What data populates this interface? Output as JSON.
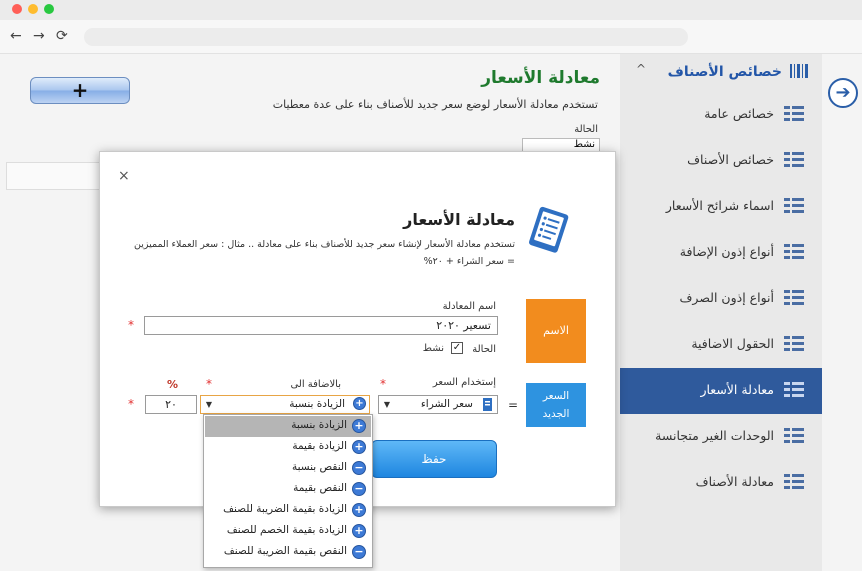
{
  "sidebar": {
    "header_title": "خصائص الأصناف",
    "items": [
      {
        "label": "خصائص عامة"
      },
      {
        "label": "خصائص الأصناف"
      },
      {
        "label": "اسماء شرائح الأسعار"
      },
      {
        "label": "أنواع إذون الإضافة"
      },
      {
        "label": "أنواع إذون الصرف"
      },
      {
        "label": "الحقول الاضافية"
      },
      {
        "label": "معادلة الأسعار"
      },
      {
        "label": "الوحدات الغير متجانسة"
      },
      {
        "label": "معادلة الأصناف"
      }
    ]
  },
  "page": {
    "title": "معادلة الأسعار",
    "description": "تستخدم معادلة الأسعار لوضع سعر جديد للأصناف بناء على عدة معطيات",
    "status_label": "الحالة",
    "status_value": "نشط",
    "add_button": "+"
  },
  "modal": {
    "close": "×",
    "title": "معادلة الأسعار",
    "description_line1": "تستخدم معادلة الأسعار لإنشاء سعر جديد للأصناف بناء على معادلة .. مثال : سعر العملاء المميزين",
    "description_line2": "= سعر الشراء + ٢٠%",
    "name_box": "الاسم",
    "new_price_box_line1": "السعر",
    "new_price_box_line2": "الجديد",
    "equation_name_label": "اسم المعادلة",
    "equation_name_value": "تسعير ٢٠٢٠",
    "status_label": "الحالة",
    "active_label": "نشط",
    "active_checked": true,
    "use_price_label": "إستخدام السعر",
    "use_price_value": "سعر الشراء",
    "addition_label": "بالاضافة الى",
    "addition_value": "الزيادة بنسبة",
    "percent_label": "%",
    "percent_value": "٢٠",
    "equals": "=",
    "required_mark": "*",
    "save_button": "حفظ"
  },
  "dropdown": {
    "options": [
      {
        "label": "الزيادة بنسبة",
        "sign": "+"
      },
      {
        "label": "الزيادة بقيمة",
        "sign": "+"
      },
      {
        "label": "النقص بنسبة",
        "sign": "−"
      },
      {
        "label": "النقص بقيمة",
        "sign": "−"
      },
      {
        "label": "الزيادة بقيمة الضريبة للصنف",
        "sign": "+"
      },
      {
        "label": "الزيادة بقيمة الخصم للصنف",
        "sign": "+"
      },
      {
        "label": "النقص بقيمة الضريبة للصنف",
        "sign": "−"
      }
    ]
  },
  "colors": {
    "active_sidebar": "#2f5a9c",
    "name_box": "#f28c1e",
    "new_price_box": "#2e93e0",
    "save_button": "#1e86e0"
  }
}
